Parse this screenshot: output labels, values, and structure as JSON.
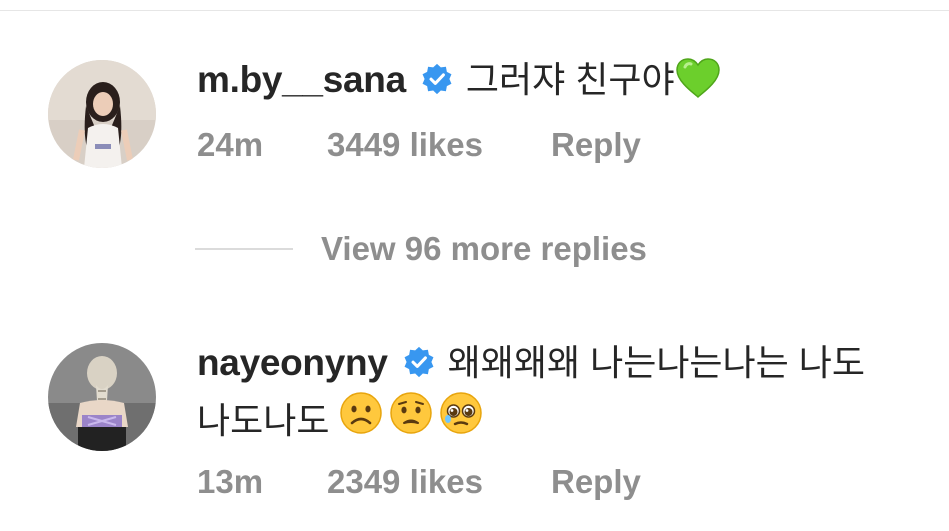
{
  "comments": [
    {
      "username": "m.by__sana",
      "verified": true,
      "text": "그러쟈 친구야",
      "emoji": [
        "green-heart"
      ],
      "time": "24m",
      "likes": "3449 likes",
      "reply_label": "Reply"
    },
    {
      "username": "nayeonyny",
      "verified": true,
      "text_line1": "왜왜왜왜 나는나는나는 나도",
      "text_line2": "나도나도",
      "emoji": [
        "frowning-face",
        "worried-face",
        "pleading-face"
      ],
      "time": "13m",
      "likes": "2349 likes",
      "reply_label": "Reply"
    }
  ],
  "view_replies_label": "View 96 more replies",
  "colors": {
    "primary_text": "#262626",
    "secondary_text": "#8e8e8e",
    "verified_blue": "#3897f0",
    "divider": "#dbdbdb",
    "heart_green": "#6ccf2c"
  }
}
